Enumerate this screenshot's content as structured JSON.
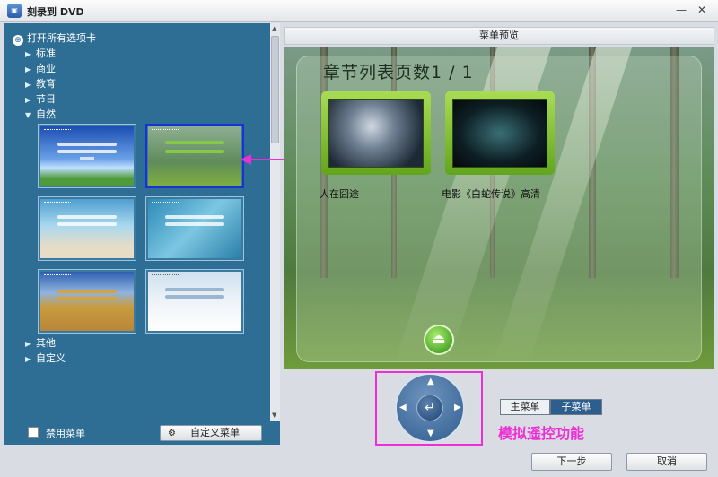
{
  "window": {
    "title": "刻录到 DVD",
    "minimize": "—",
    "close": "✕"
  },
  "left": {
    "open_all": "打开所有选项卡",
    "categories_top": [
      {
        "label": "标准",
        "expanded": false
      },
      {
        "label": "商业",
        "expanded": false
      },
      {
        "label": "教育",
        "expanded": false
      },
      {
        "label": "节日",
        "expanded": false
      },
      {
        "label": "自然",
        "expanded": true
      }
    ],
    "categories_bottom": [
      {
        "label": "其他",
        "expanded": false
      },
      {
        "label": "自定义",
        "expanded": false
      }
    ],
    "selected_thumbnail": 2,
    "disable_menu": {
      "label": "禁用菜单",
      "checked": false
    },
    "custom_menu_button": "自定义菜单"
  },
  "preview": {
    "header": "菜单预览",
    "page_title": "章节列表页数1 / 1",
    "chapters": [
      {
        "label": "人在囧途"
      },
      {
        "label": "电影《白蛇传说》高清"
      }
    ]
  },
  "menu_tabs": {
    "main": "主菜单",
    "sub": "子菜单",
    "active": "sub"
  },
  "remote_caption": "模拟遥控功能",
  "footer": {
    "next": "下一步",
    "cancel": "取消"
  },
  "colors": {
    "accent_highlight": "#ee2fd6",
    "panel": "#2f6e94",
    "selection": "#1733d8"
  },
  "icons": {
    "expand_collapsed": "triangle-right",
    "expand_open": "triangle-down",
    "home": "eject-up",
    "settings": "gear"
  }
}
